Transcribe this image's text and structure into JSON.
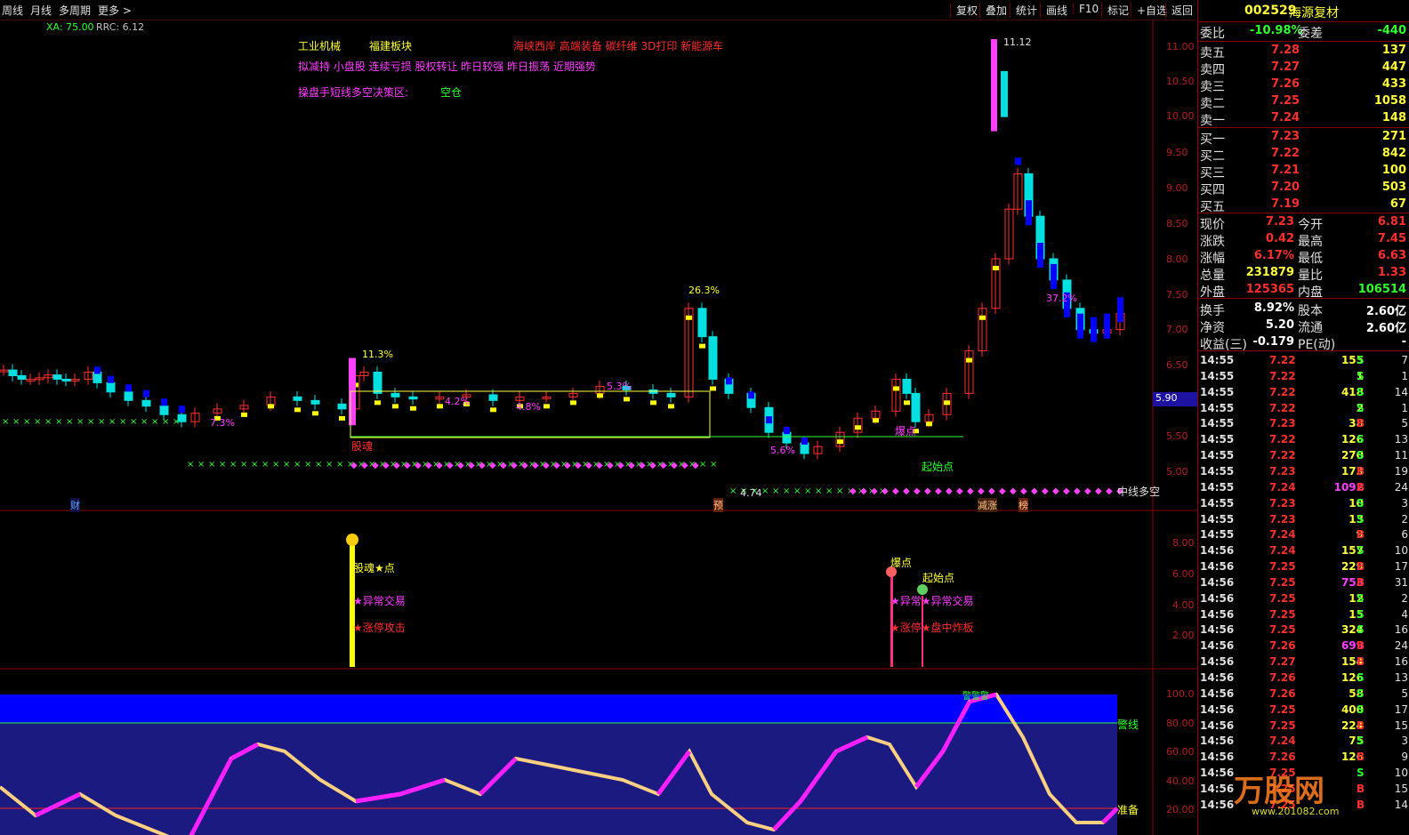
{
  "toolbar": {
    "left": [
      "周线",
      "月线",
      "多周期",
      "更多 >"
    ],
    "right": [
      "复权",
      "叠加",
      "统计",
      "画线",
      "F10",
      "标记",
      "+自选",
      "返回"
    ]
  },
  "indicator_line": {
    "xa": "XA: 75.00",
    "rrc": "RRC: 6.12"
  },
  "chart_texts": {
    "sector1": "工业机械",
    "sector2": "福建板块",
    "concepts": "海峡西岸 高端装备 碳纤维 3D打印 新能源车",
    "tags_line": "拟减持 小盘股 连续亏损 股权转让 昨日较强 昨日振荡 近期强势",
    "strategy_label": "操盘手短线多空决策区:",
    "strategy_value": "空仓",
    "high_label": "11.12",
    "pct_263": "26.3%",
    "pct_113": "11.3%",
    "pct_53": "5.3%",
    "pct_42": "4.2%",
    "pct_48": "4.8%",
    "pct_73": "7.3%",
    "pct_56": "5.6%",
    "pct_372": "37.2%",
    "gupo": "股魂",
    "baodian": "爆点",
    "qishidian": "起始点",
    "low_label": "4.74",
    "cai": "财",
    "yu": "预",
    "jianzhang": "减涨",
    "bang": "榜",
    "zhongxian": "中线多空",
    "lower_gupo": "股魂★点",
    "lower_yichang": "★异常交易",
    "lower_zhangting": "★涨停攻击",
    "lower_baodian": "爆点",
    "lower_qishi": "起始点",
    "lower_yichang2": "★异常★异常交易",
    "lower_zhangting2": "★涨停★盘中炸板",
    "jingxian": "警线",
    "zhunbei": "准备",
    "zhunbei_tags": "警警警"
  },
  "axis_main": [
    "11.00",
    "10.50",
    "10.00",
    "9.50",
    "9.00",
    "8.50",
    "8.00",
    "7.50",
    "7.00",
    "6.50",
    "5.50",
    "5.00"
  ],
  "axis_mid": [
    "8.00",
    "6.00",
    "4.00",
    "2.00"
  ],
  "axis_low": [
    "100.0",
    "80.00",
    "60.00",
    "40.00",
    "20.00"
  ],
  "price_box": "5.90",
  "quote": {
    "code": "002529",
    "name": "海源复材",
    "weibi_label": "委比",
    "weibi": "-10.98%",
    "weicha_label": "委差",
    "weicha": "-440",
    "asks": [
      {
        "label": "卖五",
        "price": "7.28",
        "vol": "137"
      },
      {
        "label": "卖四",
        "price": "7.27",
        "vol": "447"
      },
      {
        "label": "卖三",
        "price": "7.26",
        "vol": "433"
      },
      {
        "label": "卖二",
        "price": "7.25",
        "vol": "1058"
      },
      {
        "label": "卖一",
        "price": "7.24",
        "vol": "148"
      }
    ],
    "bids": [
      {
        "label": "买一",
        "price": "7.23",
        "vol": "271"
      },
      {
        "label": "买二",
        "price": "7.22",
        "vol": "842"
      },
      {
        "label": "买三",
        "price": "7.21",
        "vol": "100"
      },
      {
        "label": "买四",
        "price": "7.20",
        "vol": "503"
      },
      {
        "label": "买五",
        "price": "7.19",
        "vol": "67"
      }
    ],
    "stats": [
      {
        "l1": "现价",
        "v1": "7.23",
        "l2": "今开",
        "v2": "6.81",
        "c1": "#ff3030",
        "c2": "#ff3030"
      },
      {
        "l1": "涨跌",
        "v1": "0.42",
        "l2": "最高",
        "v2": "7.45",
        "c1": "#ff3030",
        "c2": "#ff3030"
      },
      {
        "l1": "涨幅",
        "v1": "6.17%",
        "l2": "最低",
        "v2": "6.63",
        "c1": "#ff3030",
        "c2": "#ff3030"
      },
      {
        "l1": "总量",
        "v1": "231879",
        "l2": "量比",
        "v2": "1.33",
        "c1": "#ffff40",
        "c2": "#ff3030"
      },
      {
        "l1": "外盘",
        "v1": "125365",
        "l2": "内盘",
        "v2": "106514",
        "c1": "#ff3030",
        "c2": "#30ff30"
      },
      {
        "l1": "换手",
        "v1": "8.92%",
        "l2": "股本",
        "v2": "2.60亿",
        "c1": "#ffffff",
        "c2": "#ffffff"
      },
      {
        "l1": "净资",
        "v1": "5.20",
        "l2": "流通",
        "v2": "2.60亿",
        "c1": "#ffffff",
        "c2": "#ffffff"
      },
      {
        "l1": "收益(三)",
        "v1": "-0.179",
        "l2": "PE(动)",
        "v2": "-",
        "c1": "#ffffff",
        "c2": "#ffffff"
      }
    ],
    "ticks": [
      [
        "14:55",
        "7.22",
        "155",
        "S",
        "7"
      ],
      [
        "14:55",
        "7.22",
        "1",
        "S",
        "1"
      ],
      [
        "14:55",
        "7.22",
        "418",
        "S",
        "14"
      ],
      [
        "14:55",
        "7.22",
        "2",
        "S",
        "1"
      ],
      [
        "14:55",
        "7.23",
        "38",
        "B",
        "5"
      ],
      [
        "14:55",
        "7.22",
        "126",
        "S",
        "13"
      ],
      [
        "14:55",
        "7.22",
        "270",
        "S",
        "11"
      ],
      [
        "14:55",
        "7.23",
        "173",
        "B",
        "19"
      ],
      [
        "14:55",
        "7.24",
        "1092",
        "B",
        "24"
      ],
      [
        "14:55",
        "7.23",
        "10",
        "S",
        "3"
      ],
      [
        "14:55",
        "7.23",
        "13",
        "S",
        "2"
      ],
      [
        "14:55",
        "7.24",
        "9",
        "B",
        "6"
      ],
      [
        "14:56",
        "7.24",
        "157",
        "S",
        "10"
      ],
      [
        "14:56",
        "7.25",
        "229",
        "B",
        "17"
      ],
      [
        "14:56",
        "7.25",
        "753",
        "B",
        "31"
      ],
      [
        "14:56",
        "7.25",
        "12",
        "S",
        "2"
      ],
      [
        "14:56",
        "7.25",
        "15",
        "S",
        "4"
      ],
      [
        "14:56",
        "7.25",
        "324",
        "S",
        "16"
      ],
      [
        "14:56",
        "7.26",
        "699",
        "B",
        "24"
      ],
      [
        "14:56",
        "7.27",
        "154",
        "B",
        "16"
      ],
      [
        "14:56",
        "7.26",
        "126",
        "S",
        "13"
      ],
      [
        "14:56",
        "7.26",
        "58",
        "S",
        "5"
      ],
      [
        "14:56",
        "7.25",
        "400",
        "S",
        "17"
      ],
      [
        "14:56",
        "7.25",
        "224",
        "B",
        "15"
      ],
      [
        "14:56",
        "7.24",
        "75",
        "S",
        "3"
      ],
      [
        "14:56",
        "7.26",
        "126",
        "B",
        "9"
      ],
      [
        "14:56",
        "7.25",
        "",
        "S",
        "10"
      ],
      [
        "14:56",
        "7.25",
        "",
        "B",
        "15"
      ],
      [
        "14:56",
        "7.25",
        "",
        "B",
        "14"
      ]
    ]
  },
  "watermark": "万股网",
  "watermark_url": "www.201082.com",
  "colors": {
    "up": "#ff3030",
    "down": "#00e0e0",
    "yellow": "#ffff00",
    "blue": "#0000ff",
    "magenta": "#ff00ff",
    "green": "#30ff30",
    "darkred": "#8a0000"
  },
  "chart_data": {
    "type": "candlestick",
    "title": "",
    "ylim": [
      4.6,
      11.3
    ],
    "high": 11.12,
    "low": 4.74,
    "osc_ylim": [
      0,
      100
    ],
    "osc_levels": {
      "warn": 80,
      "ready": 20
    }
  }
}
